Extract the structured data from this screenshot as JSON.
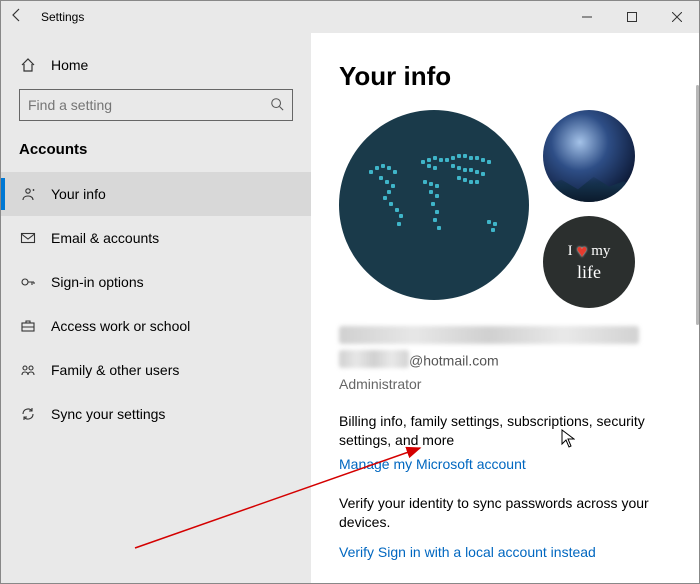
{
  "window": {
    "title": "Settings"
  },
  "sidebar": {
    "home": "Home",
    "search_placeholder": "Find a setting",
    "section": "Accounts",
    "items": [
      {
        "label": "Your info"
      },
      {
        "label": "Email & accounts"
      },
      {
        "label": "Sign-in options"
      },
      {
        "label": "Access work or school"
      },
      {
        "label": "Family & other users"
      },
      {
        "label": "Sync your settings"
      }
    ]
  },
  "main": {
    "heading": "Your info",
    "email_suffix": "@hotmail.com",
    "role": "Administrator",
    "billing_text": "Billing info, family settings, subscriptions, security settings, and more",
    "manage_link": "Manage my Microsoft account",
    "verify_text": "Verify your identity to sync passwords across your devices.",
    "verify_link": "Verify",
    "local_link": "Sign in with a local account instead",
    "avatar_life_line1a": "I",
    "avatar_life_line1b": "my",
    "avatar_life_line2": "life"
  }
}
